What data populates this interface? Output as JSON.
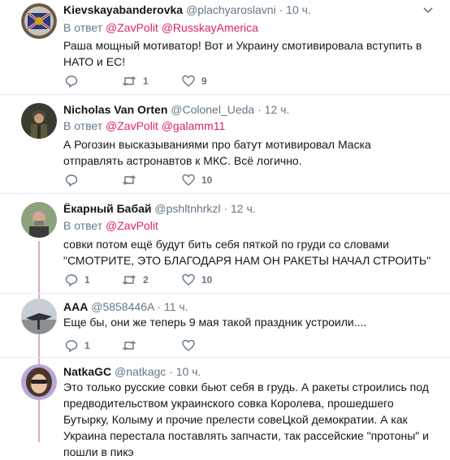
{
  "tweets": [
    {
      "name": "Kievskayabanderovka",
      "handle": "@plachyaroslavni",
      "dot": "·",
      "time": "10 ч.",
      "reply_prefix": "В ответ",
      "mentions": [
        "@ZavPolit",
        "@RusskayAmerica"
      ],
      "text": "Раша мощный мотиватор! Вот и Украину смотивировала вступить в НАТО и ЕС!",
      "replies": "",
      "retweets": "1",
      "likes": "9"
    },
    {
      "name": "Nicholas Van Orten",
      "handle": "@Colonel_Ueda",
      "dot": "·",
      "time": "12 ч.",
      "reply_prefix": "В ответ",
      "mentions": [
        "@ZavPolit",
        "@galamm11"
      ],
      "text": "А Рогозин высказываниями про батут мотивировал Маска отправлять астронавтов к МКС. Всё логично.",
      "replies": "",
      "retweets": "",
      "likes": "10"
    },
    {
      "name": "Ёкарный Бабай",
      "handle": "@pshltnhrkzl",
      "dot": "·",
      "time": "12 ч.",
      "reply_prefix": "В ответ",
      "mentions": [
        "@ZavPolit"
      ],
      "text": "совки потом ещё будут бить себя пяткой по груди со словами \"СМОТРИТЕ, ЭТО БЛАГОДАРЯ НАМ ОН РАКЕТЫ НАЧАЛ СТРОИТЬ\"",
      "replies": "1",
      "retweets": "2",
      "likes": "10"
    },
    {
      "name": "AAA",
      "handle": "@5858446A",
      "dot": "·",
      "time": "11 ч.",
      "text": "Еще бы, они же теперь 9 мая такой праздник устроили....",
      "replies": "1",
      "retweets": "",
      "likes": ""
    },
    {
      "name": "NatkaGC",
      "handle": "@natkagc",
      "dot": "·",
      "time": "10 ч.",
      "text": "Это только русские совки бьют себя в грудь. А ракеты строились под предводительством украинского совка Королева, прошедшего Бутырку, Колыму и прочие прелести совеЦкой демократии. А как Украина перестала поставлять запчасти, так рассейские \"протоны\" и пошли в пикэ"
    }
  ],
  "colors": {
    "mention": "#e0245e",
    "muted": "#657786",
    "thread_line": "#e0a8c8",
    "divider": "#e6ecf0"
  },
  "icons": [
    "reply-icon",
    "retweet-icon",
    "like-icon",
    "caret-down-icon"
  ]
}
